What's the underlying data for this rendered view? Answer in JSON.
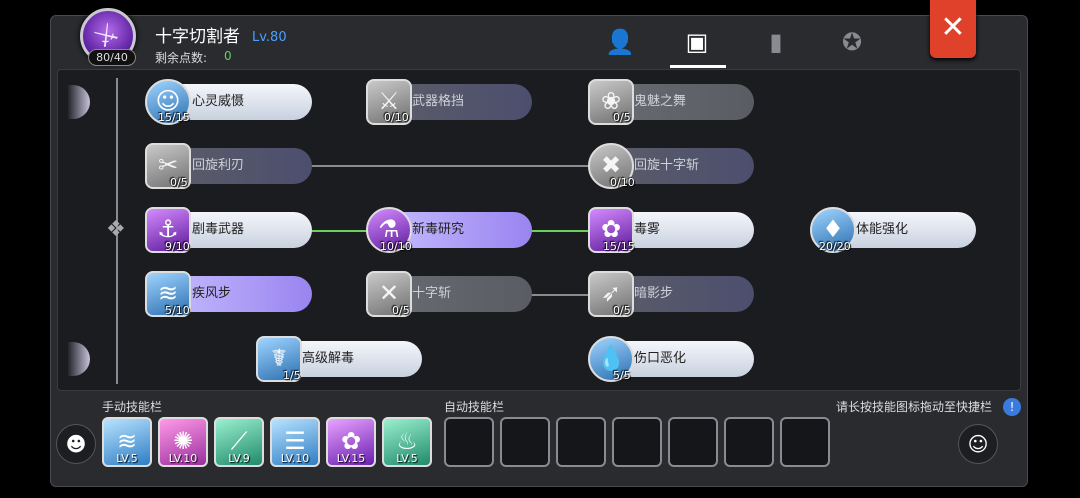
{
  "header": {
    "class_name": "十字切割者",
    "level": "Lv.80",
    "points": "80/40",
    "remain_label": "剩余点数:",
    "remain_value": "0"
  },
  "tabs": [
    {
      "name": "character-tab",
      "icon": "user-star-icon"
    },
    {
      "name": "skill-tab",
      "icon": "contact-book-icon"
    },
    {
      "name": "book-tab",
      "icon": "book-icon"
    },
    {
      "name": "badge-tab",
      "icon": "wing-shield-icon"
    }
  ],
  "skills": [
    {
      "name": "心灵威慑",
      "level": "15/15",
      "icon": "mind-icon",
      "state": "active"
    },
    {
      "name": "武器格挡",
      "level": "0/10",
      "icon": "parry-icon",
      "state": "locked"
    },
    {
      "name": "鬼魅之舞",
      "level": "0/5",
      "icon": "ghost-dance-icon",
      "state": "grey"
    },
    {
      "name": "回旋利刃",
      "level": "0/5",
      "icon": "spin-blade-icon",
      "state": "locked"
    },
    {
      "name": "回旋十字斩",
      "level": "0/10",
      "icon": "spin-cross-icon",
      "state": "locked"
    },
    {
      "name": "剧毒武器",
      "level": "9/10",
      "icon": "poison-weapon-icon",
      "state": "active"
    },
    {
      "name": "新毒研究",
      "level": "10/10",
      "icon": "poison-flask-icon",
      "state": "purple"
    },
    {
      "name": "毒雾",
      "level": "15/15",
      "icon": "poison-fog-icon",
      "state": "active"
    },
    {
      "name": "体能强化",
      "level": "20/20",
      "icon": "stamina-icon",
      "state": "active"
    },
    {
      "name": "疾风步",
      "level": "5/10",
      "icon": "wind-step-icon",
      "state": "purple"
    },
    {
      "name": "十字斩",
      "level": "0/5",
      "icon": "cross-slash-icon",
      "state": "grey"
    },
    {
      "name": "暗影步",
      "level": "0/5",
      "icon": "shadow-step-icon",
      "state": "locked"
    },
    {
      "name": "高级解毒",
      "level": "1/5",
      "icon": "detox-icon",
      "state": "active"
    },
    {
      "name": "伤口恶化",
      "level": "5/5",
      "icon": "wound-icon",
      "state": "active"
    }
  ],
  "bars": {
    "manual_label": "手动技能栏",
    "auto_label": "自动技能栏",
    "hint": "请长按技能图标拖动至快捷栏"
  },
  "manual_slots": [
    {
      "lv": "LV.5",
      "icon": "wind-step-icon"
    },
    {
      "lv": "LV.10",
      "icon": "pink-burst-icon"
    },
    {
      "lv": "LV.9",
      "icon": "green-slash-icon"
    },
    {
      "lv": "LV.10",
      "icon": "dash-icon"
    },
    {
      "lv": "LV.15",
      "icon": "poison-fog-icon"
    },
    {
      "lv": "LV.5",
      "icon": "green-flame-icon"
    }
  ]
}
